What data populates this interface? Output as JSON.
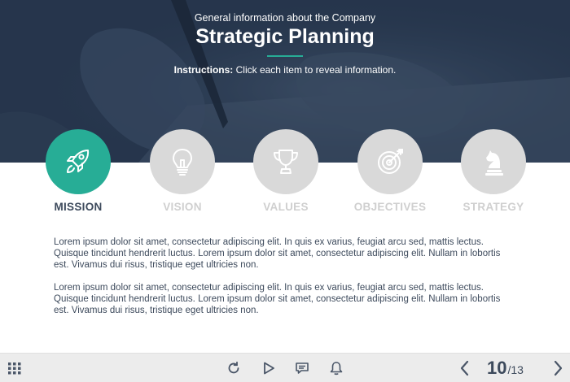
{
  "header": {
    "subtitle": "General information about the Company",
    "title": "Strategic Planning",
    "instructions_label": "Instructions:",
    "instructions_text": " Click each item to reveal information."
  },
  "tabs": [
    {
      "label": "MISSION",
      "icon": "rocket-icon",
      "active": true
    },
    {
      "label": "VISION",
      "icon": "lightbulb-icon",
      "active": false
    },
    {
      "label": "VALUES",
      "icon": "trophy-icon",
      "active": false
    },
    {
      "label": "OBJECTIVES",
      "icon": "target-icon",
      "active": false
    },
    {
      "label": "STRATEGY",
      "icon": "chess-knight-icon",
      "active": false
    }
  ],
  "content": {
    "paragraphs": [
      "Lorem ipsum dolor sit amet, consectetur adipiscing elit. In quis ex varius, feugiat arcu sed, mattis lectus. Quisque tincidunt hendrerit luctus. Lorem ipsum dolor sit amet, consectetur adipiscing elit. Nullam in lobortis est. Vivamus dui risus, tristique eget ultricies non.",
      "Lorem ipsum dolor sit amet, consectetur adipiscing elit. In quis ex varius, feugiat arcu sed, mattis lectus. Quisque tincidunt hendrerit luctus. Lorem ipsum dolor sit amet, consectetur adipiscing elit. Nullam in lobortis est. Vivamus dui risus, tristique eget ultricies non."
    ]
  },
  "toolbar": {
    "current_page": "10",
    "separator": "/",
    "total_pages": "13"
  },
  "colors": {
    "accent": "#27ad96",
    "inactive": "#d9d9d9",
    "text": "#3d4a5c",
    "banner": "#2c3d55"
  }
}
